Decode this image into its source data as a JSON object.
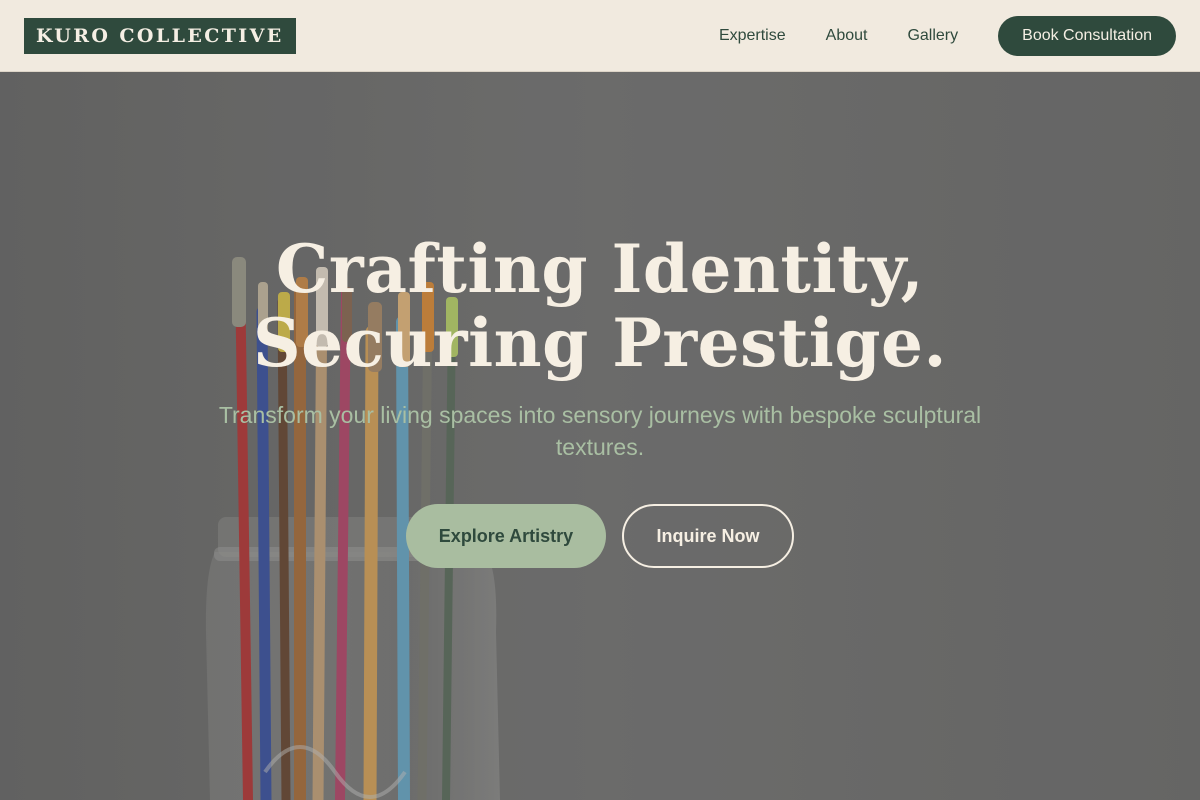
{
  "brand": {
    "logo_text": "KURO COLLECTIVE"
  },
  "nav": {
    "items": [
      {
        "label": "Expertise"
      },
      {
        "label": "About"
      },
      {
        "label": "Gallery"
      }
    ],
    "cta_label": "Book Consultation"
  },
  "hero": {
    "title_line1": "Crafting Identity,",
    "title_line2": "Securing Prestige.",
    "subtitle_line1": "Transform your living spaces into sensory journeys with bespoke sculptural",
    "subtitle_line2": "textures.",
    "primary_button": "Explore Artistry",
    "secondary_button": "Inquire Now",
    "background_image": "jar-of-paintbrushes-photo"
  },
  "colors": {
    "primary": "#2f4a3d",
    "accent": "#a9bda0",
    "nav_background": "#f1eadf",
    "hero_text": "#f6efe3"
  }
}
